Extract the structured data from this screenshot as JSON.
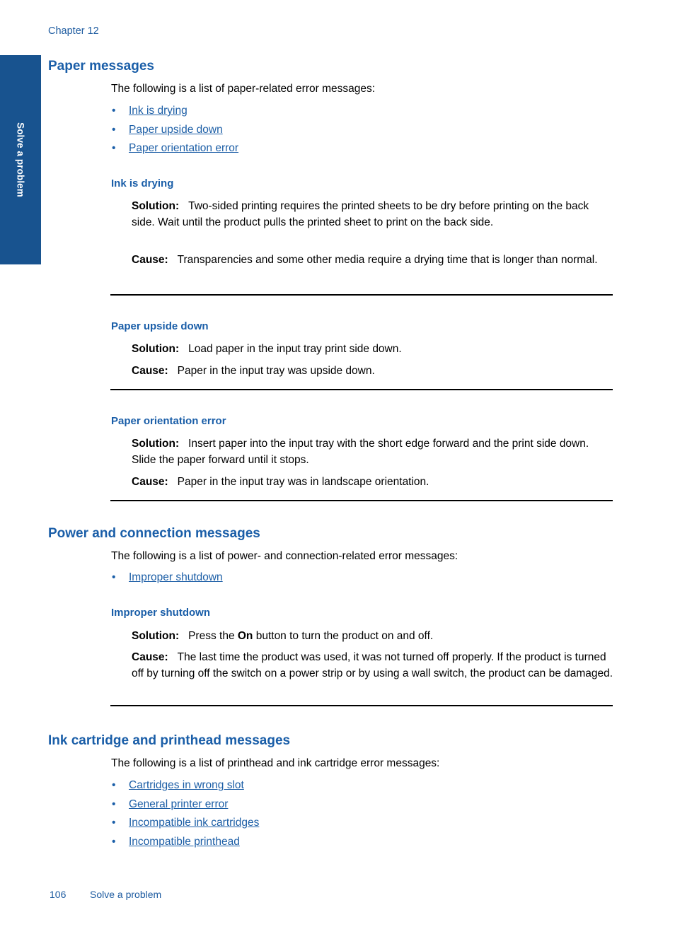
{
  "page": {
    "chapter_label": "Chapter 12",
    "side_tab_label": "Solve a problem",
    "footer_page_number": "106",
    "footer_section": "Solve a problem",
    "accent_blue": "#1a5ea8",
    "tab_blue": "#18538f",
    "link_blue": "#1c5ea6",
    "rule_color": "#000000"
  },
  "sections": {
    "paper_messages": {
      "title": "Paper messages",
      "lead": "The following is a list of paper-related error messages:",
      "links": [
        "Ink is drying",
        "Paper upside down",
        "Paper orientation error"
      ],
      "topics": {
        "ink_is_drying": {
          "title": "Ink is drying",
          "solution_label": "Solution:",
          "solution_text": "Two-sided printing requires the printed sheets to be dry before printing on the back side. Wait until the product pulls the printed sheet to print on the back side.",
          "cause_label": "Cause:",
          "cause_text": "Transparencies and some other media require a drying time that is longer than normal."
        },
        "paper_upside_down": {
          "title": "Paper upside down",
          "solution_label": "Solution:",
          "solution_text": "Load paper in the input tray print side down.",
          "cause_label": "Cause:",
          "cause_text": "Paper in the input tray was upside down."
        },
        "paper_orientation_error": {
          "title": "Paper orientation error",
          "solution_label": "Solution:",
          "solution_text": "Insert paper into the input tray with the short edge forward and the print side down. Slide the paper forward until it stops.",
          "cause_label": "Cause:",
          "cause_text": "Paper in the input tray was in landscape orientation."
        }
      }
    },
    "power_and_connection_messages": {
      "title": "Power and connection messages",
      "lead": "The following is a list of power- and connection-related error messages:",
      "links": [
        "Improper shutdown"
      ],
      "topics": {
        "improper_shutdown": {
          "title": "Improper shutdown",
          "solution_label": "Solution:",
          "solution_text_before": "Press the ",
          "solution_text_bold": "On",
          "solution_text_after": " button to turn the product on and off.",
          "cause_label": "Cause:",
          "cause_text": "The last time the product was used, it was not turned off properly. If the product is turned off by turning off the switch on a power strip or by using a wall switch, the product can be damaged."
        }
      }
    },
    "ink_cartridge_and_printhead_messages": {
      "title": "Ink cartridge and printhead messages",
      "lead": "The following is a list of printhead and ink cartridge error messages:",
      "links": [
        "Cartridges in wrong slot",
        "General printer error",
        "Incompatible ink cartridges",
        "Incompatible printhead"
      ]
    }
  },
  "bullet_glyph": "•"
}
